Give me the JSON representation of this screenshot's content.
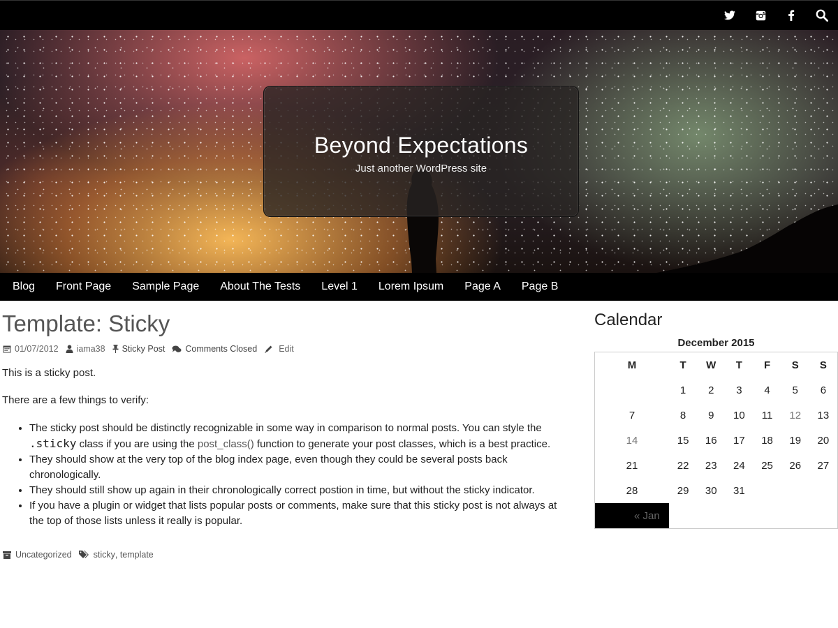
{
  "social": {
    "icons": [
      "twitter-icon",
      "instagram-icon",
      "facebook-icon",
      "search-icon"
    ]
  },
  "header": {
    "title": "Beyond Expectations",
    "tagline": "Just another WordPress site"
  },
  "nav": {
    "items": [
      "Blog",
      "Front Page",
      "Sample Page",
      "About The Tests",
      "Level 1",
      "Lorem Ipsum",
      "Page A",
      "Page B"
    ]
  },
  "post": {
    "title": "Template: Sticky",
    "date": "01/07/2012",
    "author": "iama38",
    "sticky_label": "Sticky Post",
    "comments": "Comments Closed",
    "edit": "Edit",
    "p1": "This is a sticky post.",
    "p2": "There are a few things to verify:",
    "bullet1_a": "The sticky post should be distinctly recognizable in some way in comparison to normal posts. You can style the ",
    "bullet1_code": ".sticky",
    "bullet1_b": " class if you are using the ",
    "bullet1_link": "post_class()",
    "bullet1_c": " function to generate your post classes, which is a best practice.",
    "bullet2": "They should show at the very top of the blog index page, even though they could be several posts back chronologically.",
    "bullet3": "They should still show up again in their chronologically correct postion in time, but without the sticky indicator.",
    "bullet4": "If you have a plugin or widget that lists popular posts or comments, make sure that this sticky post is not always at the top of those lists unless it really is popular.",
    "category": "Uncategorized",
    "tag1": "sticky",
    "tag2": "template"
  },
  "sidebar": {
    "calendar_title": "Calendar",
    "month": "December 2015",
    "weekdays": [
      "M",
      "T",
      "W",
      "T",
      "F",
      "S",
      "S"
    ],
    "weeks": [
      [
        "",
        "1",
        "2",
        "3",
        "4",
        "5",
        "6"
      ],
      [
        "7",
        "8",
        "9",
        "10",
        "11",
        "12",
        "13"
      ],
      [
        "14",
        "15",
        "16",
        "17",
        "18",
        "19",
        "20"
      ],
      [
        "21",
        "22",
        "23",
        "24",
        "25",
        "26",
        "27"
      ],
      [
        "28",
        "29",
        "30",
        "31",
        "",
        "",
        ""
      ]
    ],
    "prev_link": "« Jan"
  }
}
